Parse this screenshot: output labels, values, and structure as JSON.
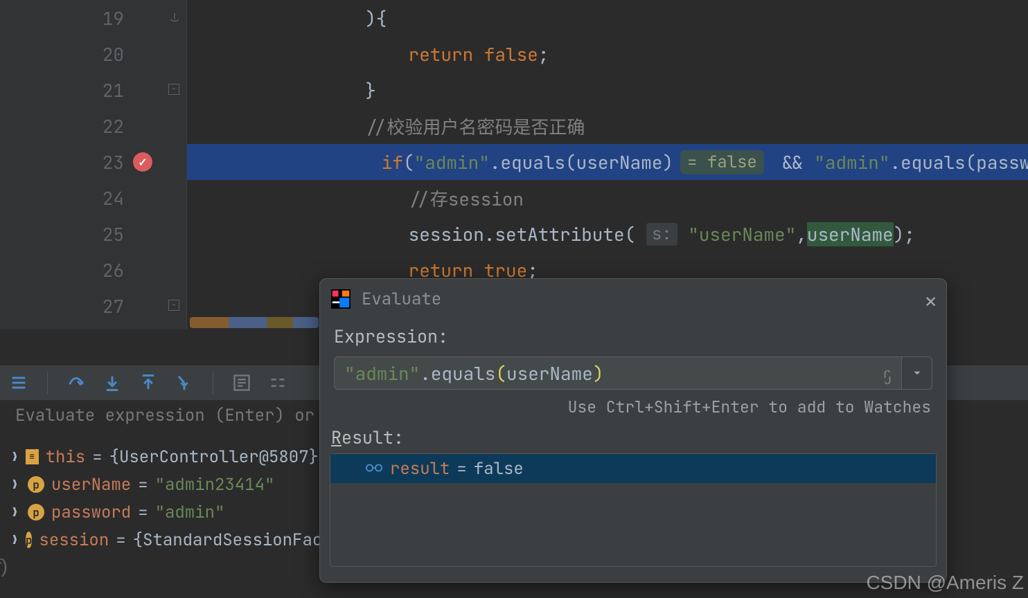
{
  "editor": {
    "lines": [
      {
        "num": 19,
        "tokens": [
          {
            "cls": "c-paren",
            "t": "){"
          }
        ],
        "indent": "            ",
        "fold": "end"
      },
      {
        "num": 20,
        "tokens": [
          {
            "cls": "c-keyword",
            "t": "return false"
          },
          {
            "cls": "c-ident",
            "t": ";"
          }
        ],
        "indent": "                "
      },
      {
        "num": 21,
        "tokens": [
          {
            "cls": "c-paren",
            "t": "}"
          }
        ],
        "indent": "            ",
        "fold": "minus"
      },
      {
        "num": 22,
        "tokens": [
          {
            "cls": "c-comment",
            "t": "//校验用户名密码是否正确"
          }
        ],
        "indent": "            "
      },
      {
        "num": 23,
        "highlight": true,
        "breakpoint": true,
        "bulb": true,
        "indent": "            ",
        "tokens": [
          {
            "cls": "c-keyword",
            "t": "if"
          },
          {
            "cls": "c-paren",
            "t": "("
          },
          {
            "cls": "c-string",
            "t": "\"admin\""
          },
          {
            "cls": "c-ident",
            "t": ".equals(userName)"
          },
          {
            "cls": "inline",
            "t": "= false"
          },
          {
            "cls": "c-ident",
            "t": " && "
          },
          {
            "cls": "c-string",
            "t": "\"admin\""
          },
          {
            "cls": "c-ident",
            "t": ".equals(passwor"
          }
        ]
      },
      {
        "num": 24,
        "tokens": [
          {
            "cls": "c-comment",
            "t": "//存session"
          }
        ],
        "indent": "                "
      },
      {
        "num": 25,
        "indent": "                ",
        "tokens": [
          {
            "cls": "c-ident",
            "t": "session.setAttribute( "
          },
          {
            "cls": "param",
            "t": "s:"
          },
          {
            "cls": "c-string",
            "t": " \"userName\""
          },
          {
            "cls": "c-ident",
            "t": ","
          },
          {
            "cls": "usage",
            "t": "userName"
          },
          {
            "cls": "c-ident",
            "t": ");"
          }
        ]
      },
      {
        "num": 26,
        "tokens": [
          {
            "cls": "c-keyword",
            "t": "return true"
          },
          {
            "cls": "c-ident",
            "t": ";"
          }
        ],
        "indent": "                "
      },
      {
        "num": 27,
        "tokens": [
          {
            "cls": "c-paren",
            "t": "}"
          }
        ],
        "indent": "            ",
        "fold": "minus"
      }
    ]
  },
  "watch_placeholder": "Evaluate expression (Enter) or",
  "variables": [
    {
      "icon": "obj",
      "name": "this",
      "value": "{UserController@5807}",
      "type": "obj"
    },
    {
      "icon": "p",
      "name": "userName",
      "value": "\"admin23414\"",
      "type": "str"
    },
    {
      "icon": "p",
      "name": "password",
      "value": "\"admin\"",
      "type": "str"
    },
    {
      "icon": "p",
      "name": "session",
      "value": "{StandardSessionFaca",
      "type": "obj"
    }
  ],
  "dialog": {
    "title": "Evaluate",
    "expr_label": "Expression:",
    "expression": {
      "str": "\"admin\"",
      "mid": ".equals",
      "op": "(",
      "id": "userName",
      "cp": ")"
    },
    "hint": "Use Ctrl+Shift+Enter to add to Watches",
    "result_label": "Result:",
    "result_name": "result",
    "result_value": "false"
  },
  "watermark": "CSDN @Ameris Z"
}
